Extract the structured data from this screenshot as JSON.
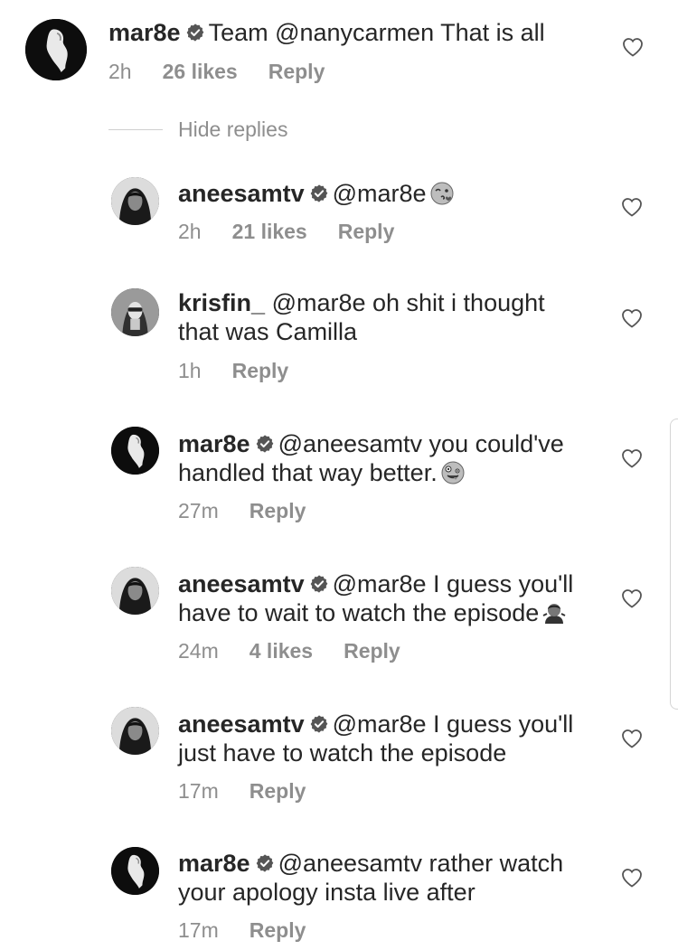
{
  "top_comment": {
    "username": "mar8e",
    "text": "Team @nanycarmen That is all",
    "time": "2h",
    "likes": "26 likes",
    "reply_label": "Reply"
  },
  "hide_replies_label": "Hide replies",
  "replies": [
    {
      "username": "aneesamtv",
      "verified": true,
      "line1": "@mar8e",
      "line2": "",
      "emoji": "kiss-wink-emoji",
      "time": "2h",
      "likes": "21 likes",
      "reply_label": "Reply"
    },
    {
      "username": "krisfin_",
      "verified": false,
      "line1": "@mar8e oh shit i thought",
      "line2": "that was Camilla",
      "emoji": "",
      "time": "1h",
      "likes": "",
      "reply_label": "Reply"
    },
    {
      "username": "mar8e",
      "verified": true,
      "line1": "@aneesamtv you could've",
      "line2": "handled that way better.",
      "emoji": "zany-face-emoji",
      "time": "27m",
      "likes": "",
      "reply_label": "Reply"
    },
    {
      "username": "aneesamtv",
      "verified": true,
      "line1": "@mar8e I guess you'll",
      "line2": "have to wait to watch the episode",
      "emoji": "shrug-woman-emoji",
      "time": "24m",
      "likes": "4 likes",
      "reply_label": "Reply"
    },
    {
      "username": "aneesamtv",
      "verified": true,
      "line1": "@mar8e I guess you'll",
      "line2": "just have to watch the episode",
      "emoji": "",
      "time": "17m",
      "likes": "",
      "reply_label": "Reply"
    },
    {
      "username": "mar8e",
      "verified": true,
      "line1": "@aneesamtv rather watch",
      "line2": "your apology insta live after",
      "emoji": "",
      "time": "17m",
      "likes": "",
      "reply_label": "Reply"
    }
  ],
  "icons": {
    "verified": "verified-badge-icon",
    "like": "heart-outline-icon"
  },
  "colors": {
    "text": "#262626",
    "meta": "#8e8e8e"
  }
}
